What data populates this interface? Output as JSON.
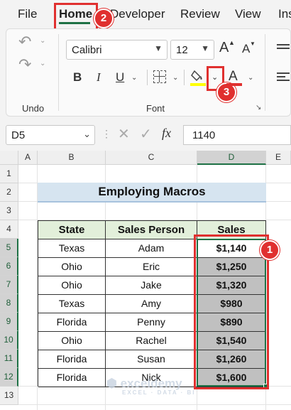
{
  "menu": {
    "file": "File",
    "home": "Home",
    "developer": "Developer",
    "review": "Review",
    "view": "View",
    "insert_partial": "Ins"
  },
  "ribbon": {
    "undo_label": "Undo",
    "font_label": "Font",
    "font_name": "Calibri",
    "font_size": "12",
    "bold": "B",
    "italic": "I",
    "underline": "U",
    "font_color_glyph": "A",
    "grow_glyph": "A",
    "shrink_glyph": "A"
  },
  "formula_bar": {
    "name_box": "D5",
    "fx": "fx",
    "value": "1140"
  },
  "columns": [
    "A",
    "B",
    "C",
    "D",
    "E"
  ],
  "rows": [
    "1",
    "2",
    "3",
    "4",
    "5",
    "6",
    "7",
    "8",
    "9",
    "10",
    "11",
    "12",
    "13"
  ],
  "sheet": {
    "title": "Employing Macros",
    "headers": [
      "State",
      "Sales Person",
      "Sales"
    ],
    "data": [
      [
        "Texas",
        "Adam",
        "$1,140"
      ],
      [
        "Ohio",
        "Eric",
        "$1,250"
      ],
      [
        "Ohio",
        "Jake",
        "$1,320"
      ],
      [
        "Texas",
        "Amy",
        "$980"
      ],
      [
        "Florida",
        "Penny",
        "$890"
      ],
      [
        "Ohio",
        "Rachel",
        "$1,540"
      ],
      [
        "Florida",
        "Susan",
        "$1,260"
      ],
      [
        "Florida",
        "Nick",
        "$1,600"
      ]
    ]
  },
  "annotations": {
    "badge_1": "1",
    "badge_2": "2",
    "badge_3": "3"
  },
  "watermark": {
    "name": "exceldemy",
    "tagline": "EXCEL · DATA · BI"
  },
  "colors": {
    "accent_green": "#1e7145",
    "annotation_red": "#e0302f",
    "header_fill": "#e2efda",
    "title_fill": "#d6e4f0",
    "selection_fill": "#c0c0c0"
  }
}
